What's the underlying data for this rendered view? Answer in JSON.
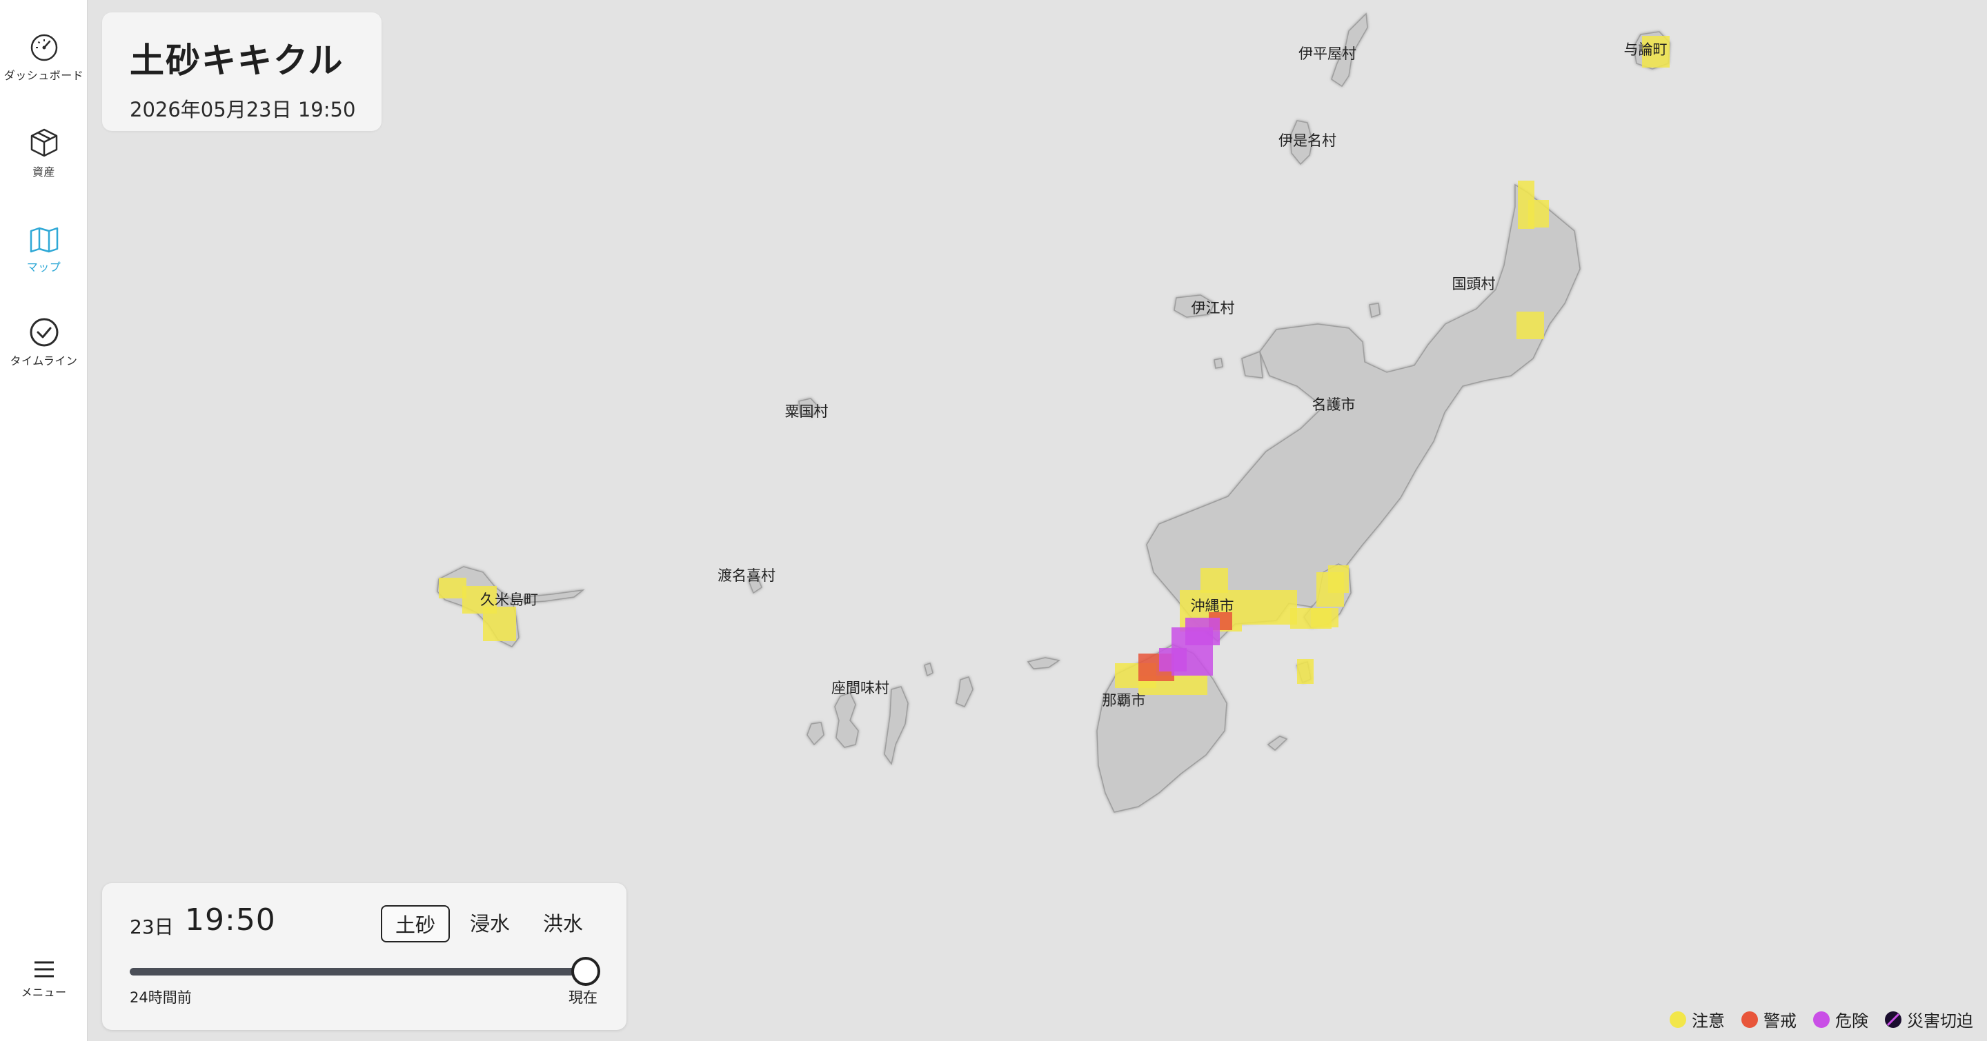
{
  "sidebar": {
    "items": [
      {
        "label": "ダッシュボード",
        "icon": "speedometer-icon",
        "active": false
      },
      {
        "label": "資産",
        "icon": "box-icon",
        "active": false
      },
      {
        "label": "マップ",
        "icon": "map-icon",
        "active": true
      },
      {
        "label": "タイムライン",
        "icon": "check-circle-icon",
        "active": false
      }
    ],
    "menu_label": "メニュー",
    "menu_icon": "hamburger-icon",
    "active_color": "#2ea8d6"
  },
  "title_card": {
    "title": "土砂キキクル",
    "datetime": "2026年05月23日 19:50"
  },
  "map": {
    "place_labels": [
      "伊平屋村",
      "与論町",
      "伊是名村",
      "国頭村",
      "伊江村",
      "名護市",
      "粟国村",
      "渡名喜村",
      "久米島町",
      "沖縄市",
      "座間味村",
      "那覇市"
    ]
  },
  "control": {
    "day": "23日",
    "time": "19:50",
    "tabs": [
      {
        "label": "土砂",
        "active": true
      },
      {
        "label": "浸水",
        "active": false
      },
      {
        "label": "洪水",
        "active": false
      }
    ],
    "slider": {
      "start_label": "24時間前",
      "end_label": "現在",
      "value_fraction": 1.0
    }
  },
  "legend": [
    {
      "label": "注意",
      "color": "#f2e64a"
    },
    {
      "label": "警戒",
      "color": "#e8553a"
    },
    {
      "label": "危険",
      "color": "#c94fe6"
    },
    {
      "label": "災害切迫",
      "color": "#1a0d2e"
    }
  ]
}
